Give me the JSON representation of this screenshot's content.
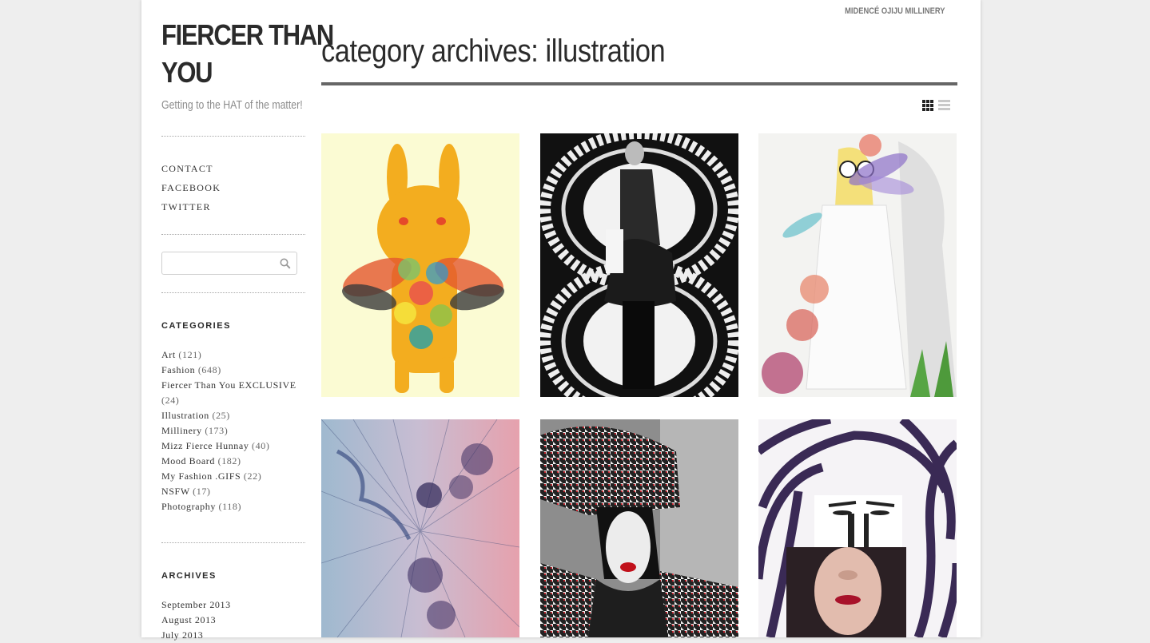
{
  "site": {
    "title_line1": "FIERCER THAN",
    "title_line2": "YOU",
    "tagline": "Getting to the HAT of the matter!",
    "top_link": "MIDENCÉ OJIJU MILLINERY"
  },
  "nav": [
    "CONTACT",
    "FACEBOOK",
    "TWITTER"
  ],
  "search": {
    "placeholder": "",
    "icon": "search-icon"
  },
  "categories": {
    "title": "CATEGORIES",
    "items": [
      {
        "label": "Art",
        "count": "(121)"
      },
      {
        "label": "Fashion",
        "count": "(648)"
      },
      {
        "label": "Fiercer Than You EXCLUSIVE",
        "count": "(24)"
      },
      {
        "label": "Illustration",
        "count": "(25)"
      },
      {
        "label": "Millinery",
        "count": "(173)"
      },
      {
        "label": "Mizz Fierce Hunnay",
        "count": "(40)"
      },
      {
        "label": "Mood Board",
        "count": "(182)"
      },
      {
        "label": "My Fashion .GIFS",
        "count": "(22)"
      },
      {
        "label": "NSFW",
        "count": "(17)"
      },
      {
        "label": "Photography",
        "count": "(118)"
      }
    ]
  },
  "archives": {
    "title": "ARCHIVES",
    "items": [
      "September 2013",
      "August 2013",
      "July 2013"
    ]
  },
  "main": {
    "page_title": "category archives: illustration",
    "view_modes": [
      "grid-view-icon",
      "list-view-icon"
    ],
    "active_view": "grid"
  },
  "colors": {
    "background": "#eeeeee",
    "page": "#ffffff",
    "rule": "#666666"
  }
}
